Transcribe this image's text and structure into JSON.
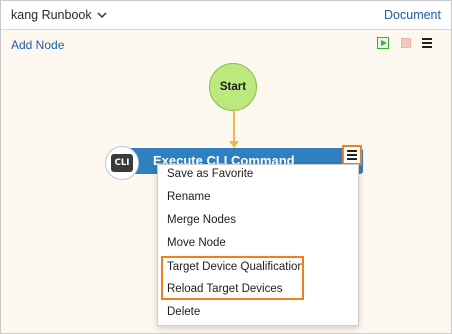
{
  "header": {
    "runbook_title": "kang Runbook",
    "document_label": "Document"
  },
  "toolbar": {
    "add_node_label": "Add Node",
    "play_icon": "play-icon",
    "stop_icon": "stop-icon",
    "menu_icon": "hamburger-menu-icon",
    "colors": {
      "link": "#1f5fa0",
      "play": "#3fae3f",
      "stop": "#f6c7c1"
    }
  },
  "canvas": {
    "start_node_label": "Start",
    "node": {
      "badge": "CLI",
      "title": "Execute CLI Command",
      "color": "#2f80c0"
    },
    "connector_color": "#f0b74c",
    "start_color": "#bde87e"
  },
  "context_menu": {
    "items": [
      "Save as Favorite",
      "Rename",
      "Merge Nodes",
      "Move Node",
      "Target Device Qualification",
      "Reload Target Devices",
      "Delete"
    ],
    "highlight_color": "#f07f20"
  }
}
